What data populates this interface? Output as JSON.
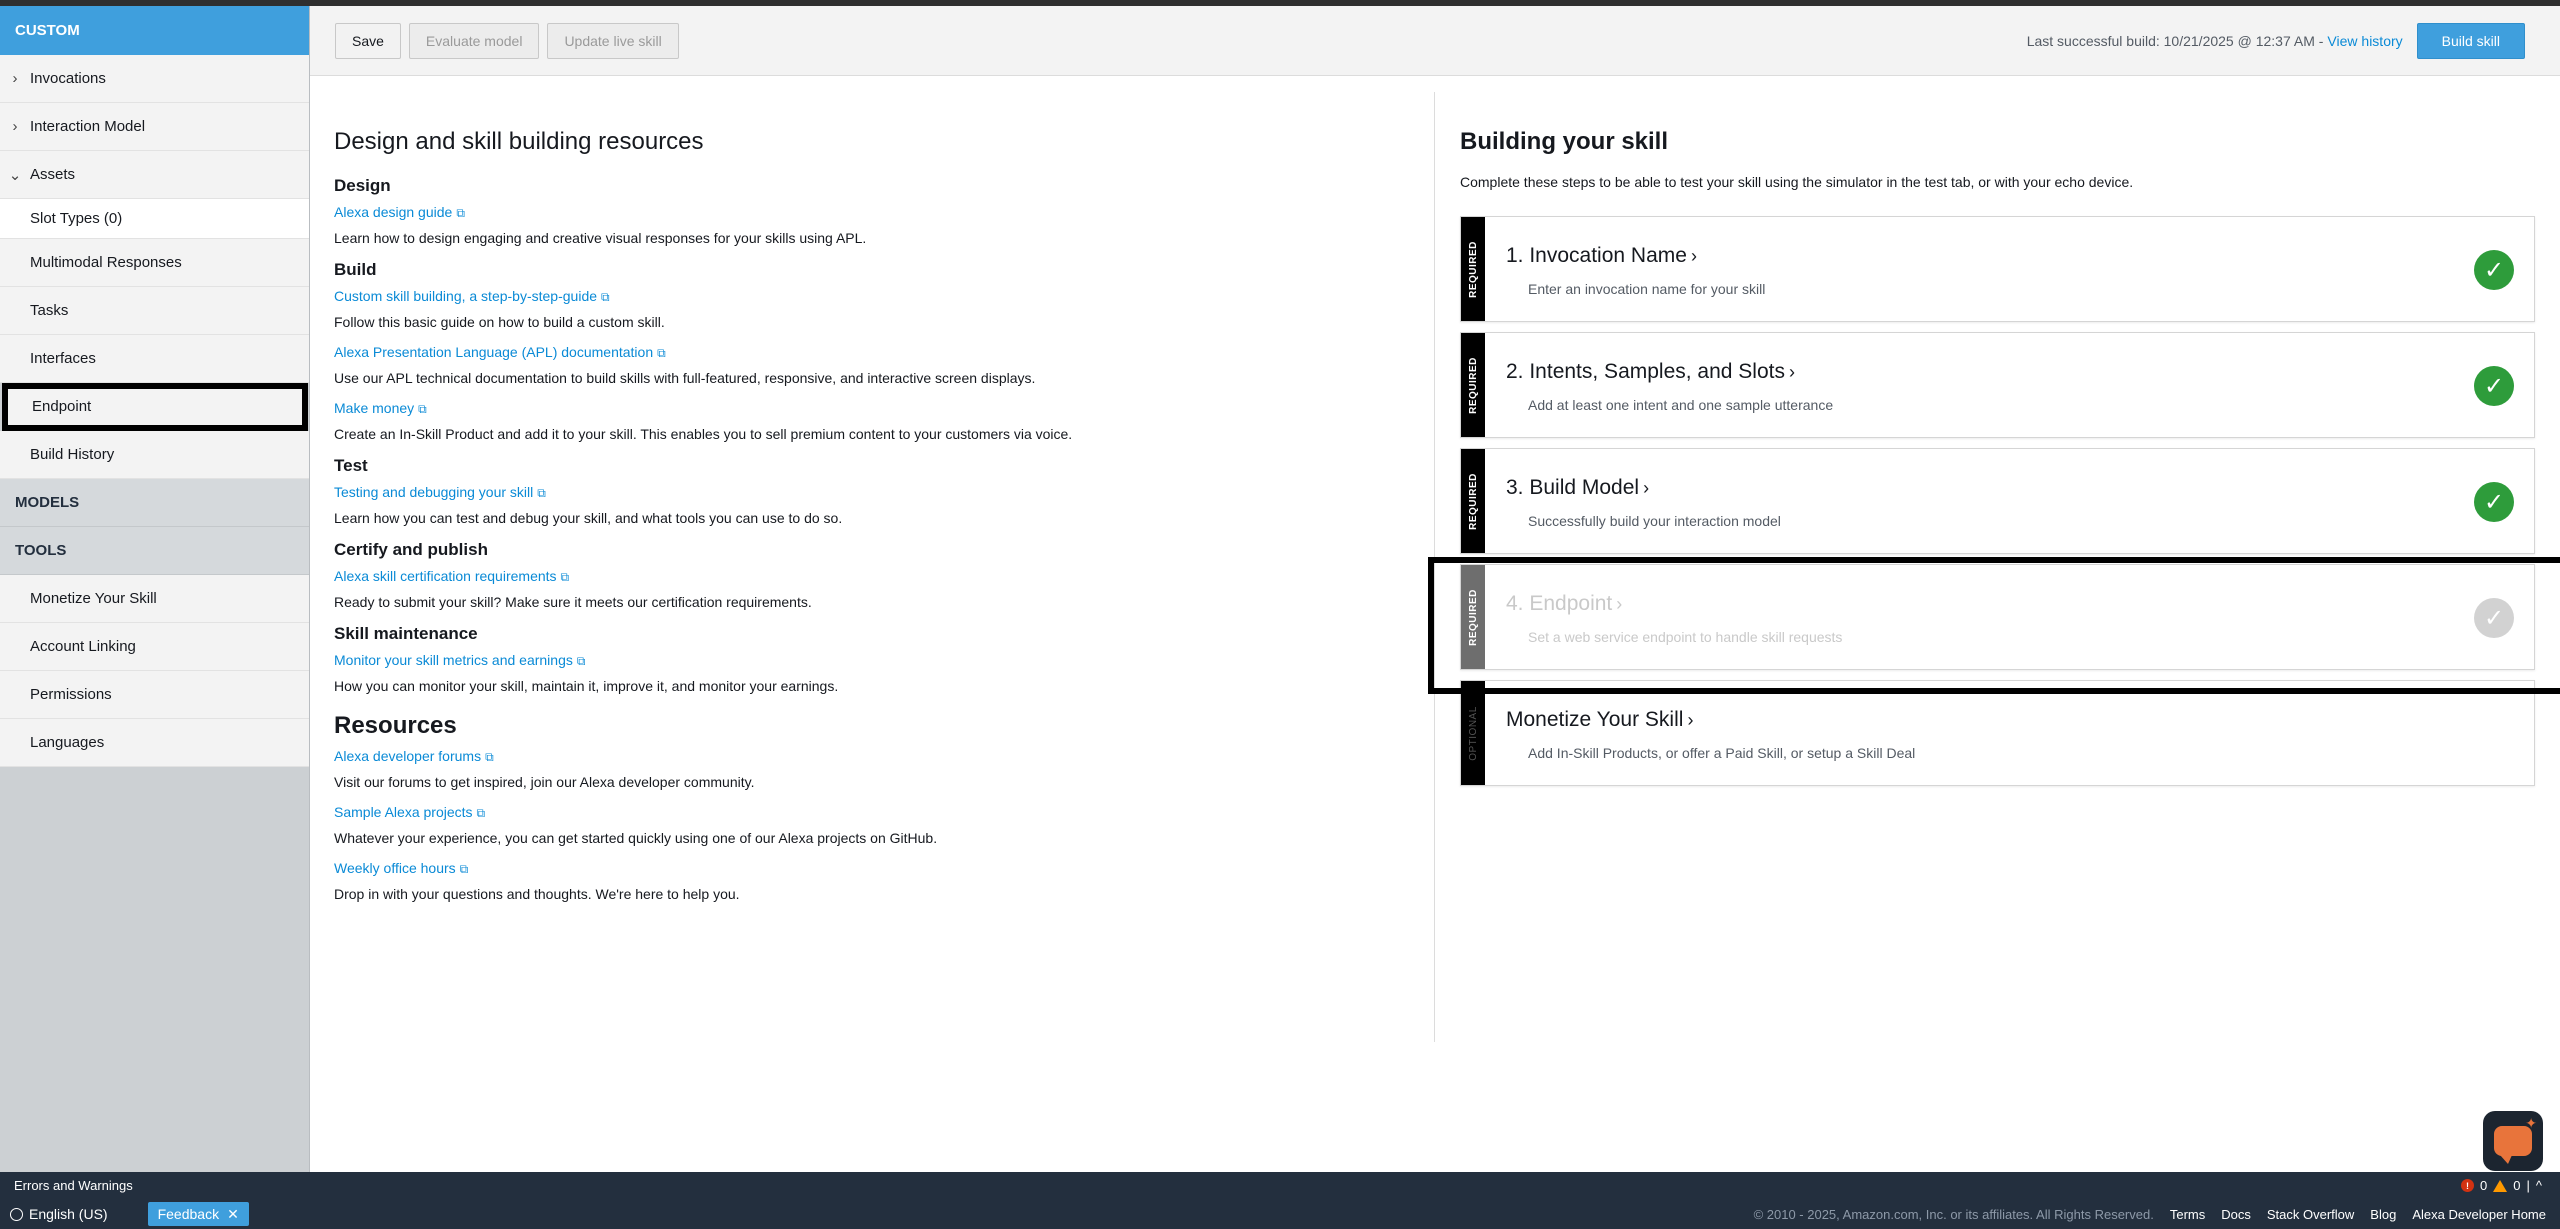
{
  "sidebar": {
    "custom_label": "CUSTOM",
    "items": [
      {
        "label": "Invocations",
        "chevron": "›"
      },
      {
        "label": "Interaction Model",
        "chevron": "›"
      },
      {
        "label": "Assets",
        "chevron": "⌄"
      }
    ],
    "asset_children": [
      {
        "label": "Slot Types (0)"
      },
      {
        "label": "Multimodal Responses"
      },
      {
        "label": "Tasks"
      },
      {
        "label": "Interfaces"
      },
      {
        "label": "Endpoint"
      },
      {
        "label": "Build History"
      }
    ],
    "models_label": "MODELS",
    "tools_label": "TOOLS",
    "tools_children": [
      {
        "label": "Monetize Your Skill"
      },
      {
        "label": "Account Linking"
      },
      {
        "label": "Permissions"
      },
      {
        "label": "Languages"
      }
    ]
  },
  "toolbar": {
    "save_label": "Save",
    "evaluate_label": "Evaluate model",
    "update_label": "Update live skill",
    "last_build_text": "Last successful build: 10/21/2025 @ 12:37 AM -",
    "view_history_label": "View history",
    "build_label": "Build skill"
  },
  "resources": {
    "title": "Design and skill building resources",
    "sections": [
      {
        "heading": "Design",
        "links": [
          {
            "label": "Alexa design guide",
            "desc": "Learn how to design engaging and creative visual responses for your skills using APL."
          }
        ]
      },
      {
        "heading": "Build",
        "links": [
          {
            "label": "Custom skill building, a step-by-step-guide",
            "desc": "Follow this basic guide on how to build a custom skill."
          },
          {
            "label": "Alexa Presentation Language (APL) documentation",
            "desc": "Use our APL technical documentation to build skills with full-featured, responsive, and interactive screen displays."
          },
          {
            "label": "Make money",
            "desc": "Create an In-Skill Product and add it to your skill. This enables you to sell premium content to your customers via voice."
          }
        ]
      },
      {
        "heading": "Test",
        "links": [
          {
            "label": "Testing and debugging your skill",
            "desc": "Learn how you can test and debug your skill, and what tools you can use to do so."
          }
        ]
      },
      {
        "heading": "Certify and publish",
        "links": [
          {
            "label": "Alexa skill certification requirements",
            "desc": "Ready to submit your skill? Make sure it meets our certification requirements."
          }
        ]
      },
      {
        "heading": "Skill maintenance",
        "links": [
          {
            "label": "Monitor your skill metrics and earnings",
            "desc": "How you can monitor your skill, maintain it, improve it, and monitor your earnings."
          }
        ]
      }
    ],
    "resources_heading": "Resources",
    "resources_links": [
      {
        "label": "Alexa developer forums",
        "desc": "Visit our forums to get inspired, join our Alexa developer community."
      },
      {
        "label": "Sample Alexa projects",
        "desc": "Whatever your experience, you can get started quickly using one of our Alexa projects on GitHub."
      },
      {
        "label": "Weekly office hours",
        "desc": "Drop in with your questions and thoughts. We're here to help you."
      }
    ],
    "ext_icon": "🔗"
  },
  "building": {
    "title": "Building your skill",
    "desc": "Complete these steps to be able to test your skill using the simulator in the test tab, or with your echo device.",
    "steps": [
      {
        "tag": "REQUIRED",
        "title": "1. Invocation Name",
        "sub": "Enter an invocation name for your skill",
        "check": "✓"
      },
      {
        "tag": "REQUIRED",
        "title": "2. Intents, Samples, and Slots",
        "sub": "Add at least one intent and one sample utterance",
        "check": "✓"
      },
      {
        "tag": "REQUIRED",
        "title": "3. Build Model",
        "sub": "Successfully build your interaction model",
        "check": "✓"
      },
      {
        "tag": "REQUIRED",
        "title": "4. Endpoint",
        "sub": "Set a web service endpoint to handle skill requests",
        "check": "✓"
      },
      {
        "tag": "OPTIONAL",
        "title": "Monetize Your Skill",
        "sub": "Add In-Skill Products, or offer a Paid Skill, or setup a Skill Deal"
      }
    ],
    "arrow": "›"
  },
  "statusbar": {
    "errors_label": "Errors and Warnings",
    "error_count": "0",
    "warning_count": "0",
    "sep": "|",
    "collapse": "^"
  },
  "footer": {
    "language": "English (US)",
    "feedback_label": "Feedback",
    "close": "✕",
    "copyright": "© 2010 - 2025, Amazon.com, Inc. or its affiliates. All Rights Reserved.",
    "links": [
      "Terms",
      "Docs",
      "Stack Overflow",
      "Blog",
      "Alexa Developer Home"
    ]
  },
  "colors": {
    "accent": "#3f9fdd",
    "link": "#0a8ad6",
    "success": "#2e9c3b",
    "nav_dark": "#232f3e"
  }
}
